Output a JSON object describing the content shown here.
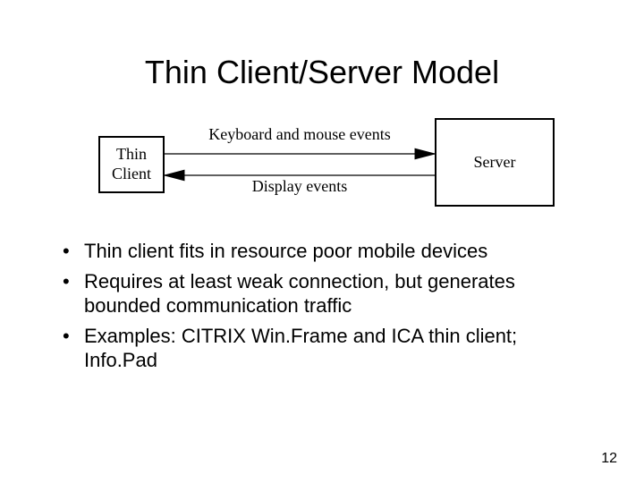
{
  "title": "Thin Client/Server Model",
  "diagram": {
    "client_label": "Thin\nClient",
    "server_label": "Server",
    "top_arrow_label": "Keyboard and mouse events",
    "bottom_arrow_label": "Display events"
  },
  "bullets": [
    "Thin client fits in resource poor mobile devices",
    "Requires at least weak connection, but generates bounded communication traffic",
    "Examples: CITRIX Win.Frame and ICA thin client; Info.Pad"
  ],
  "page_number": "12"
}
